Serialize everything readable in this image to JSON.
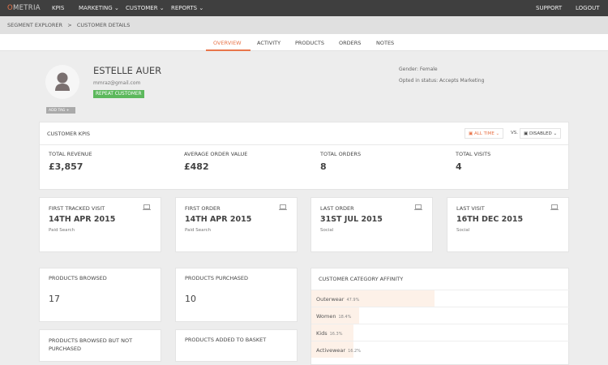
{
  "nav": {
    "logo": "OMETRIA",
    "logo_first": "O",
    "logo_rest": "METRIA",
    "items": [
      "KPIS",
      "MARKETING",
      "CUSTOMER",
      "REPORTS"
    ],
    "right": [
      "SUPPORT",
      "LOGOUT"
    ]
  },
  "breadcrumb": {
    "parent": "SEGMENT EXPLORER",
    "sep": ">",
    "current": "CUSTOMER DETAILS"
  },
  "tabs": [
    "OVERVIEW",
    "ACTIVITY",
    "PRODUCTS",
    "ORDERS",
    "NOTES"
  ],
  "active_tab": "OVERVIEW",
  "profile": {
    "name": "ESTELLE AUER",
    "email": "mmraz@gmail.com",
    "badge": "REPEAT CUSTOMER",
    "add_tag": "ADD TAG",
    "gender": "Gender: Female",
    "opted": "Opted in status: Accepts Marketing"
  },
  "kpis": {
    "title": "CUSTOMER KPIS",
    "range": "ALL TIME",
    "vs": "VS.",
    "compare": "DISABLED",
    "items": [
      {
        "label": "TOTAL REVENUE",
        "value": "£3,857"
      },
      {
        "label": "AVERAGE ORDER VALUE",
        "value": "£482"
      },
      {
        "label": "TOTAL ORDERS",
        "value": "8"
      },
      {
        "label": "TOTAL VISITS",
        "value": "4"
      }
    ]
  },
  "events": [
    {
      "label": "FIRST TRACKED VISIT",
      "date": "14TH APR 2015",
      "source": "Paid Search"
    },
    {
      "label": "FIRST ORDER",
      "date": "14TH APR 2015",
      "source": "Paid Search"
    },
    {
      "label": "LAST ORDER",
      "date": "31ST JUL 2015",
      "source": "Social"
    },
    {
      "label": "LAST VISIT",
      "date": "16TH DEC 2015",
      "source": "Social"
    }
  ],
  "products": [
    {
      "label": "PRODUCTS BROWSED",
      "value": "17"
    },
    {
      "label": "PRODUCTS PURCHASED",
      "value": "10"
    },
    {
      "label": "PRODUCTS BROWSED BUT NOT PURCHASED"
    },
    {
      "label": "PRODUCTS ADDED TO BASKET"
    }
  ],
  "affinity": {
    "title": "CUSTOMER CATEGORY AFFINITY",
    "rows": [
      {
        "name": "Outerwear",
        "pct": "47.9%",
        "value": 47.9
      },
      {
        "name": "Women",
        "pct": "18.4%",
        "value": 18.4
      },
      {
        "name": "Kids",
        "pct": "16.3%",
        "value": 16.3
      },
      {
        "name": "Activewear",
        "pct": "16.2%",
        "value": 16.2
      }
    ]
  },
  "colors": {
    "accent": "#e8754a",
    "badge": "#5cb85c",
    "nav": "#3f3f3f"
  }
}
